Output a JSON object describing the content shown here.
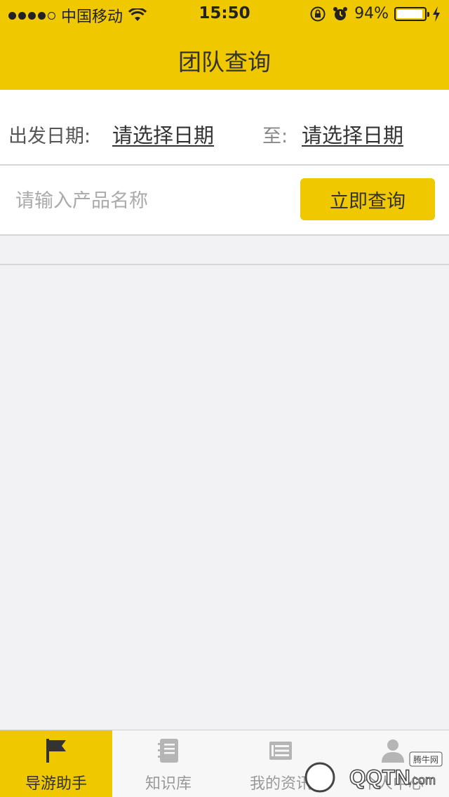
{
  "status_bar": {
    "carrier": "中国移动",
    "time": "15:50",
    "battery": "94%",
    "battery_level": 0.94,
    "signal_bars_filled": 4,
    "signal_bars_total": 5
  },
  "nav": {
    "title": "团队查询"
  },
  "form": {
    "date_label": "出发日期:",
    "start_date": "请选择日期",
    "to_label": "至:",
    "end_date": "请选择日期",
    "product_placeholder": "请输入产品名称",
    "product_value": "",
    "query_button": "立即查询"
  },
  "tabbar": {
    "tabs": [
      {
        "label": "导游助手",
        "icon": "flag-icon",
        "active": true
      },
      {
        "label": "知识库",
        "icon": "notebook-icon",
        "active": false
      },
      {
        "label": "我的资讯",
        "icon": "news-icon",
        "active": false
      },
      {
        "label": "个人中心",
        "icon": "person-icon",
        "active": false
      }
    ]
  },
  "watermark": {
    "text": "QQTN.com",
    "subtext": "腾牛网"
  },
  "colors": {
    "accent": "#f0c800",
    "background": "#f2f2f4"
  }
}
